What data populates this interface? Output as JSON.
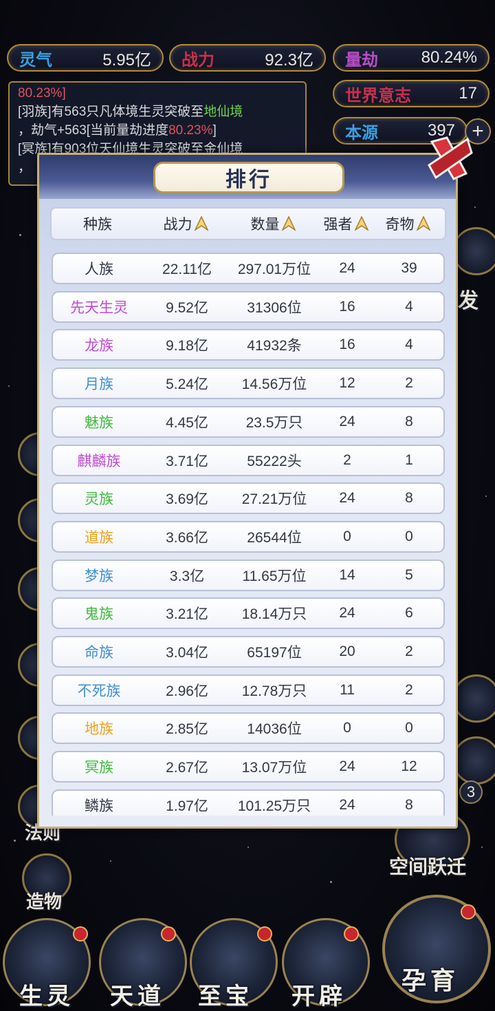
{
  "colors": {
    "gold": "#b08a3c",
    "stat_label": "#c9304a",
    "stat_label_alt": "#b84ec8",
    "race_black": "#333844",
    "race_pink": "#c04ad2",
    "race_blue": "#3e8fd6",
    "race_green": "#3ebb3c",
    "race_orange": "#f0a11a"
  },
  "stats": {
    "lingqi": {
      "label": "灵气",
      "value": "5.95亿"
    },
    "zhanli": {
      "label": "战力",
      "value": "92.3亿"
    },
    "liangjie": {
      "label": "量劫",
      "value": "80.24%"
    },
    "world_will": {
      "label": "世界意志",
      "value": "17"
    },
    "benyuan": {
      "label": "本源",
      "value": "397"
    }
  },
  "log": {
    "line1": "80.23%]",
    "line2_a": "[羽族]有563只凡体境生灵突破至",
    "line2_b": "地仙境",
    "line3_a": "，劫气+563[当前量劫进度",
    "line3_b": "80.23%",
    "line3_c": "]",
    "line4": "[冥族]有903位天仙境生灵突破至金仙境",
    "line5": "，"
  },
  "sidebar_left": {
    "fazi": "法则",
    "zaowu": "造物"
  },
  "sidebar_right": {
    "kongjian": "空间跃迁",
    "badge": "3",
    "partial_fa": "发"
  },
  "nav": {
    "shengling": "生灵",
    "tiandao": "天道",
    "zhibao": "至宝",
    "kaipi": "开辟",
    "yunyu": "孕育"
  },
  "modal": {
    "title": "排行",
    "headers": {
      "race": "种族",
      "power": "战力",
      "count": "数量",
      "strong": "强者",
      "treasure": "奇物"
    },
    "rows": [
      {
        "race": "人族",
        "color": "#333844",
        "power": "22.11亿",
        "count": "297.01万位",
        "strong": "24",
        "treasure": "39"
      },
      {
        "race": "先天生灵",
        "color": "#c04ad2",
        "power": "9.52亿",
        "count": "31306位",
        "strong": "16",
        "treasure": "4"
      },
      {
        "race": "龙族",
        "color": "#c04ad2",
        "power": "9.18亿",
        "count": "41932条",
        "strong": "16",
        "treasure": "4"
      },
      {
        "race": "月族",
        "color": "#3e8fd6",
        "power": "5.24亿",
        "count": "14.56万位",
        "strong": "12",
        "treasure": "2"
      },
      {
        "race": "魅族",
        "color": "#3ebb3c",
        "power": "4.45亿",
        "count": "23.5万只",
        "strong": "24",
        "treasure": "8"
      },
      {
        "race": "麒麟族",
        "color": "#c04ad2",
        "power": "3.71亿",
        "count": "55222头",
        "strong": "2",
        "treasure": "1"
      },
      {
        "race": "灵族",
        "color": "#3ebb3c",
        "power": "3.69亿",
        "count": "27.21万位",
        "strong": "24",
        "treasure": "8"
      },
      {
        "race": "道族",
        "color": "#f0a11a",
        "power": "3.66亿",
        "count": "26544位",
        "strong": "0",
        "treasure": "0"
      },
      {
        "race": "梦族",
        "color": "#3e8fd6",
        "power": "3.3亿",
        "count": "11.65万位",
        "strong": "14",
        "treasure": "5"
      },
      {
        "race": "鬼族",
        "color": "#3ebb3c",
        "power": "3.21亿",
        "count": "18.14万只",
        "strong": "24",
        "treasure": "6"
      },
      {
        "race": "命族",
        "color": "#3e8fd6",
        "power": "3.04亿",
        "count": "65197位",
        "strong": "20",
        "treasure": "2"
      },
      {
        "race": "不死族",
        "color": "#3e8fd6",
        "power": "2.96亿",
        "count": "12.78万只",
        "strong": "11",
        "treasure": "2"
      },
      {
        "race": "地族",
        "color": "#f0a11a",
        "power": "2.85亿",
        "count": "14036位",
        "strong": "0",
        "treasure": "0"
      },
      {
        "race": "冥族",
        "color": "#3ebb3c",
        "power": "2.67亿",
        "count": "13.07万位",
        "strong": "24",
        "treasure": "12"
      },
      {
        "race": "鳞族",
        "color": "#333844",
        "power": "1.97亿",
        "count": "101.25万只",
        "strong": "24",
        "treasure": "8"
      }
    ]
  }
}
